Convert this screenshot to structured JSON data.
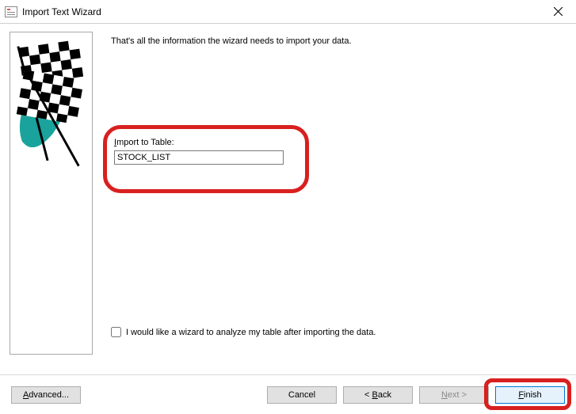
{
  "window": {
    "title": "Import Text Wizard"
  },
  "intro_text": "That's all the information the wizard needs to import your data.",
  "import_to_table": {
    "label_prefix": "I",
    "label_rest": "mport to Table:",
    "value": "STOCK_LIST"
  },
  "analyze_checkbox": {
    "checked": false,
    "label": "I would like a wizard to analyze my table after importing the data."
  },
  "buttons": {
    "advanced_prefix": "A",
    "advanced_rest": "dvanced...",
    "cancel": "Cancel",
    "back_prefix": "< ",
    "back_ul": "B",
    "back_rest": "ack",
    "next_ul": "N",
    "next_rest": "ext >",
    "finish_ul": "F",
    "finish_rest": "inish"
  }
}
